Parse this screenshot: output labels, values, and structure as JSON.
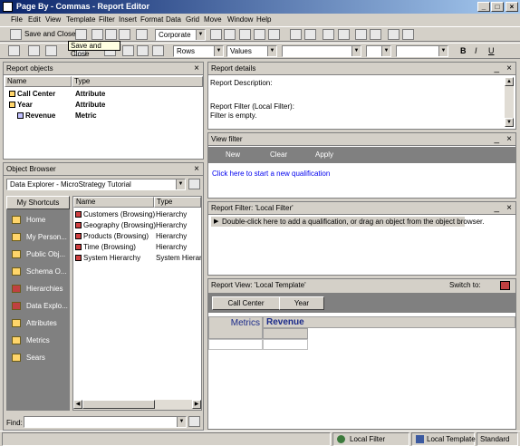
{
  "window": {
    "title": "Page By - Commas - Report Editor",
    "min": "_",
    "max": "□",
    "close": "×"
  },
  "menu": [
    "File",
    "Edit",
    "View",
    "Template",
    "Filter",
    "Insert",
    "Format",
    "Data",
    "Grid",
    "Move",
    "Window",
    "Help"
  ],
  "toolbar1": {
    "save_close": "Save and Close",
    "template_select": "Corporate"
  },
  "toolbar2": {
    "rows_select": "Rows",
    "values_select": "Values",
    "tooltip": "Save and Close",
    "bold": "B",
    "italic": "I",
    "underline": "U"
  },
  "report_objects": {
    "title": "Report objects",
    "col_name": "Name",
    "col_type": "Type",
    "items": [
      {
        "name": "Call Center",
        "type": "Attribute"
      },
      {
        "name": "Year",
        "type": "Attribute"
      },
      {
        "name": "Revenue",
        "type": "Metric"
      }
    ]
  },
  "object_browser": {
    "title": "Object Browser",
    "source": "Data Explorer - MicroStrategy Tutorial",
    "shortcuts_tab": "My Shortcuts",
    "nav": [
      "Home",
      "My Person...",
      "Public Obj...",
      "Schema O...",
      "Hierarchies",
      "Data Explo...",
      "Attributes",
      "Metrics",
      "Sears"
    ],
    "col_name": "Name",
    "col_type": "Type",
    "items": [
      {
        "name": "Customers (Browsing)",
        "type": "Hierarchy"
      },
      {
        "name": "Geography (Browsing)",
        "type": "Hierarchy"
      },
      {
        "name": "Products (Browsing)",
        "type": "Hierarchy"
      },
      {
        "name": "Time (Browsing)",
        "type": "Hierarchy"
      },
      {
        "name": "System Hierarchy",
        "type": "System Hierarch"
      }
    ],
    "find_label": "Find:"
  },
  "report_details": {
    "title": "Report details",
    "line1": "Report Description:",
    "line2": "Report Filter (Local Filter):",
    "line3": "Filter is empty."
  },
  "view_filter": {
    "title": "View filter",
    "new": "New",
    "clear": "Clear",
    "apply": "Apply",
    "link": "Click here to start a new qualification"
  },
  "report_filter": {
    "title": "Report Filter: 'Local Filter'",
    "hint": "Double-click here to add a qualification, or drag an object from the object browser."
  },
  "report_view": {
    "title": "Report View: 'Local Template'",
    "switch_to": "Switch to:",
    "btn_call_center": "Call Center",
    "btn_year": "Year",
    "metrics": "Metrics",
    "revenue": "Revenue"
  },
  "status": {
    "local_filter": "Local Filter",
    "local_template": "Local Template",
    "mode": "Standard"
  }
}
